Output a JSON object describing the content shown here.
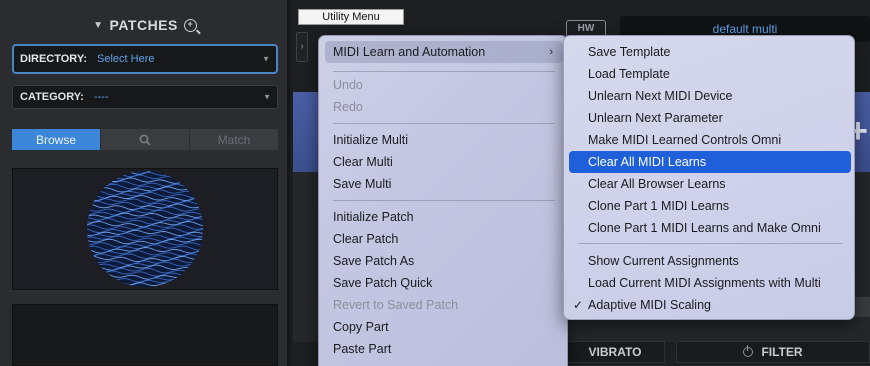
{
  "patches": {
    "title": "PATCHES",
    "directory_label": "DIRECTORY:",
    "directory_value": "Select Here",
    "category_label": "CATEGORY:",
    "category_value": "----",
    "tabs": [
      "Browse",
      "",
      "Match"
    ]
  },
  "top": {
    "utility_menu_label": "Utility Menu",
    "hw_label": "HW",
    "multi_name": "default multi"
  },
  "buttons": {
    "vibrato": "VIBRATO",
    "filter": "FILTER"
  },
  "main_menu": {
    "items": [
      {
        "label": "MIDI Learn and Automation",
        "enabled": true,
        "submenu": true
      },
      {
        "label": "Undo",
        "enabled": false
      },
      {
        "label": "Redo",
        "enabled": false
      },
      {
        "label": "Initialize Multi",
        "enabled": true
      },
      {
        "label": "Clear Multi",
        "enabled": true
      },
      {
        "label": "Save Multi",
        "enabled": true
      },
      {
        "label": "Initialize Patch",
        "enabled": true
      },
      {
        "label": "Clear Patch",
        "enabled": true
      },
      {
        "label": "Save Patch As",
        "enabled": true
      },
      {
        "label": "Save Patch Quick",
        "enabled": true
      },
      {
        "label": "Revert to Saved Patch",
        "enabled": false
      },
      {
        "label": "Copy Part",
        "enabled": true
      },
      {
        "label": "Paste Part",
        "enabled": true
      }
    ]
  },
  "sub_menu": {
    "items": [
      {
        "label": "Save Template"
      },
      {
        "label": "Load Template"
      },
      {
        "label": "Unlearn Next MIDI Device"
      },
      {
        "label": "Unlearn Next Parameter"
      },
      {
        "label": "Make MIDI Learned Controls Omni"
      },
      {
        "label": "Clear All MIDI Learns",
        "selected": true
      },
      {
        "label": "Clear All Browser Learns"
      },
      {
        "label": "Clone Part 1 MIDI Learns"
      },
      {
        "label": "Clone Part 1 MIDI Learns and Make Omni"
      },
      {
        "label": "Show Current Assignments"
      },
      {
        "label": "Load Current MIDI Assignments with Multi"
      },
      {
        "label": "Adaptive MIDI Scaling",
        "checked": true
      }
    ]
  },
  "icons": {
    "zoom": "zoom-in-icon",
    "search": "search-icon",
    "submenu": "chevron-right-icon",
    "check": "checkmark-icon",
    "power": "power-icon"
  },
  "colors": {
    "accent_blue": "#3b86d8",
    "selection_blue": "#1f5fd9",
    "link_blue": "#5fa3ec",
    "panel_dark": "#2a2c30"
  }
}
